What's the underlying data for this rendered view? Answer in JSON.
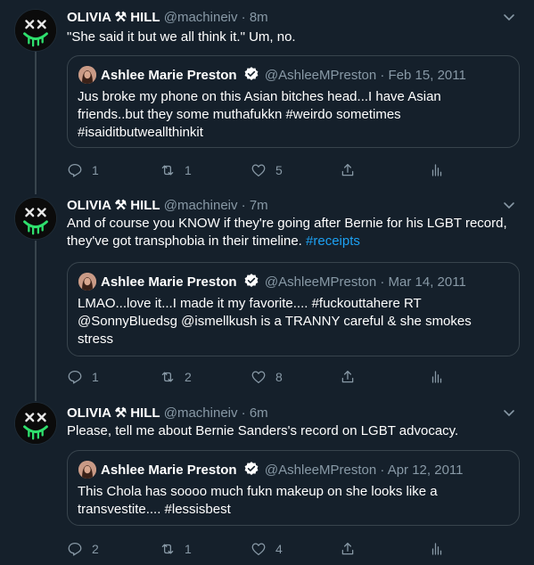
{
  "tweets": [
    {
      "name": "OLIVIA ⚒ HILL",
      "handle": "@machineiv",
      "time": "8m",
      "text": "\"She said it but we all think it.\" Um, no.",
      "link": "",
      "quote": {
        "name": "Ashlee Marie Preston",
        "handle": "@AshleeMPreston",
        "date": "Feb 15, 2011",
        "lines": [
          "Jus broke my phone on this Asian bitches head...I have Asian",
          "friends..but they some muthafukkn #weirdo sometimes",
          "#isaiditbutweallthinkit"
        ]
      },
      "counts": {
        "reply": "1",
        "retweet": "1",
        "like": "5"
      }
    },
    {
      "name": "OLIVIA ⚒ HILL",
      "handle": "@machineiv",
      "time": "7m",
      "text": "And of course you KNOW if they're going after Bernie for his LGBT record, they've got transphobia in their timeline. ",
      "link": "#receipts",
      "quote": {
        "name": "Ashlee Marie Preston",
        "handle": "@AshleeMPreston",
        "date": "Mar 14, 2011",
        "lines": [
          "LMAO...love it...I made it my favorite.... #fuckouttahere RT",
          "@SonnyBluedsg @ismellkush is a TRANNY careful & she smokes",
          "stress"
        ]
      },
      "counts": {
        "reply": "1",
        "retweet": "2",
        "like": "8"
      }
    },
    {
      "name": "OLIVIA ⚒ HILL",
      "handle": "@machineiv",
      "time": "6m",
      "text": "Please, tell me about Bernie Sanders's record on LGBT advocacy.",
      "link": "",
      "quote": {
        "name": "Ashlee Marie Preston",
        "handle": "@AshleeMPreston",
        "date": "Apr 12, 2011",
        "lines": [
          "This Chola has soooo much fukn makeup on she looks like a",
          "transvestite.... #lessisbest"
        ]
      },
      "counts": {
        "reply": "2",
        "retweet": "1",
        "like": "4"
      }
    }
  ],
  "separator": "·",
  "icons": {
    "avatar": "dead-smiley-icon",
    "verified": "verified-badge-icon",
    "chevron": "chevron-down-icon",
    "reply": "reply-icon",
    "retweet": "retweet-icon",
    "like": "heart-icon",
    "share": "share-icon",
    "analytics": "analytics-icon"
  },
  "colors": {
    "background": "#15202b",
    "border": "#38444d",
    "muted": "#8899a6",
    "link": "#1da1f2",
    "verified": "#ffffff",
    "avatar_accent": "#2ee06d"
  }
}
